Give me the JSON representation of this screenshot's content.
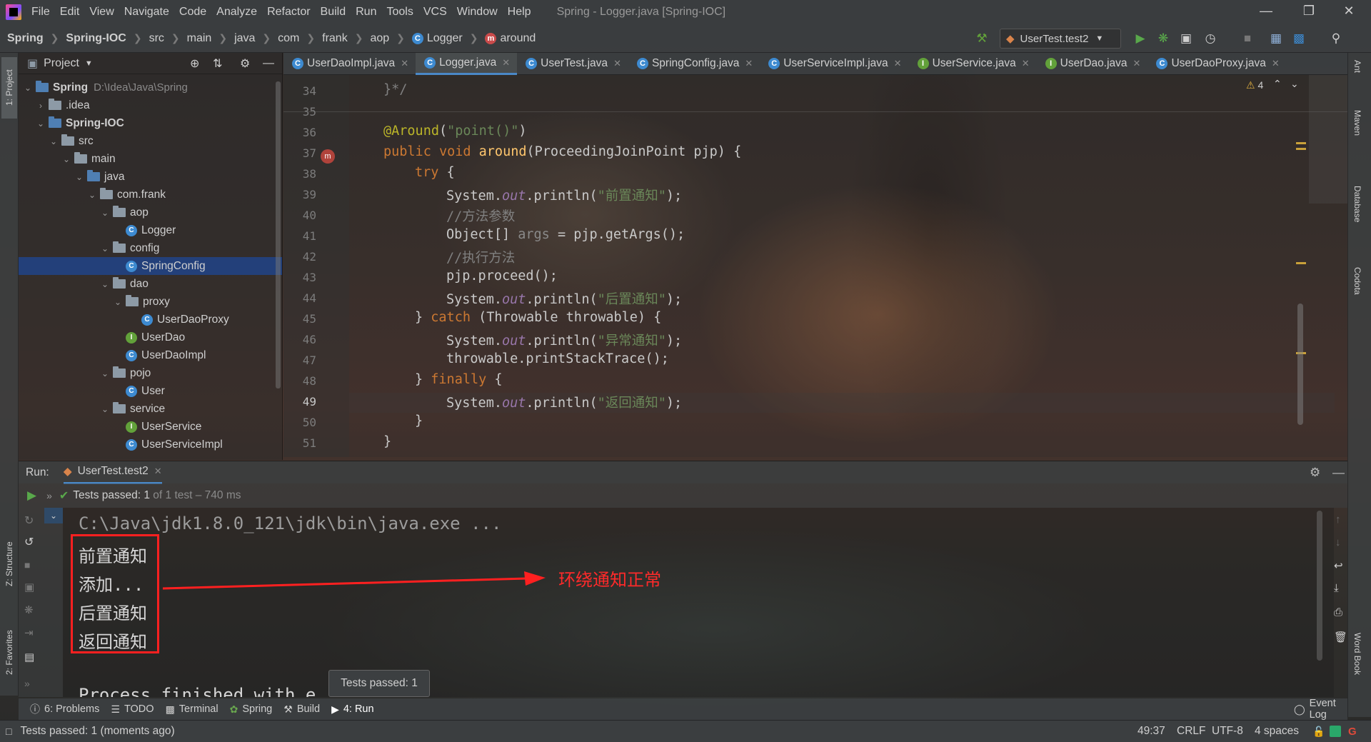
{
  "menubar": {
    "items": [
      "File",
      "Edit",
      "View",
      "Navigate",
      "Code",
      "Analyze",
      "Refactor",
      "Build",
      "Run",
      "Tools",
      "VCS",
      "Window",
      "Help"
    ],
    "window_title": "Spring - Logger.java [Spring-IOC]"
  },
  "navbar": {
    "crumbs": [
      "Spring",
      "Spring-IOC",
      "src",
      "main",
      "java",
      "com",
      "frank",
      "aop",
      "Logger",
      "around"
    ],
    "run_config": "UserTest.test2"
  },
  "left_strip": {
    "project_tab": "1: Project",
    "structure_tab": "Z: Structure",
    "favorites_tab": "2: Favorites"
  },
  "project_panel": {
    "title": "Project",
    "tree": [
      {
        "label": "Spring",
        "path": "D:\\Idea\\Java\\Spring"
      },
      {
        "label": ".idea"
      },
      {
        "label": "Spring-IOC"
      },
      {
        "label": "src"
      },
      {
        "label": "main"
      },
      {
        "label": "java"
      },
      {
        "label": "com.frank"
      },
      {
        "label": "aop"
      },
      {
        "label": "Logger"
      },
      {
        "label": "config"
      },
      {
        "label": "SpringConfig"
      },
      {
        "label": "dao"
      },
      {
        "label": "proxy"
      },
      {
        "label": "UserDaoProxy"
      },
      {
        "label": "UserDao"
      },
      {
        "label": "UserDaoImpl"
      },
      {
        "label": "pojo"
      },
      {
        "label": "User"
      },
      {
        "label": "service"
      },
      {
        "label": "UserService"
      },
      {
        "label": "UserServiceImpl"
      }
    ]
  },
  "editor_tabs": [
    "UserDaoImpl.java",
    "Logger.java",
    "UserTest.java",
    "SpringConfig.java",
    "UserServiceImpl.java",
    "UserService.java",
    "UserDao.java",
    "UserDaoProxy.java"
  ],
  "editor": {
    "warning_count": "4",
    "line_numbers": [
      "34",
      "35",
      "36",
      "37",
      "38",
      "39",
      "40",
      "41",
      "42",
      "43",
      "44",
      "45",
      "46",
      "47",
      "48",
      "49",
      "50",
      "51"
    ],
    "code": {
      "l34": "}*/",
      "l36_ann": "@Around",
      "l36_rest": "(",
      "l36_str": "\"point()\"",
      "l36_end": ")",
      "l37_kw": "public void ",
      "l37_fn": "around",
      "l37_rest": "(ProceedingJoinPoint pjp) {",
      "l38_kw": "try",
      "l38_rest": " {",
      "sys": "System.",
      "out": "out",
      "println": ".println(",
      "l39_str": "\"前置通知\"",
      "close": ");",
      "l40": "//方法参数",
      "l41_a": "Object[] ",
      "l41_b": "args",
      "l41_c": " = pjp.getArgs();",
      "l42": "//执行方法",
      "l43": "pjp.proceed();",
      "l44_str": "\"后置通知\"",
      "l45_a": "} ",
      "l45_kw": "catch",
      "l45_b": " (Throwable throwable) {",
      "l46_str": "\"异常通知\"",
      "l47": "throwable.printStackTrace();",
      "l48_a": "} ",
      "l48_kw": "finally",
      "l48_b": " {",
      "l49_str": "\"返回通知\"",
      "l50": "}",
      "l51": "}"
    }
  },
  "right_strip": {
    "tabs": [
      "Ant",
      "Maven",
      "Database",
      "Codota",
      "Word Book"
    ]
  },
  "run_panel": {
    "label": "Run:",
    "tab": "UserTest.test2",
    "status_prefix": "Tests passed: ",
    "status_count": "1",
    "status_suffix": " of 1 test – 740 ms",
    "console": [
      "C:\\Java\\jdk1.8.0_121\\jdk\\bin\\java.exe ...",
      "前置通知",
      "添加...",
      "后置通知",
      "返回通知",
      "",
      "Process finished with e"
    ],
    "annotation": "环绕通知正常",
    "tooltip": "Tests passed: 1"
  },
  "bottom_tabs": [
    "6: Problems",
    "TODO",
    "Terminal",
    "Spring",
    "Build",
    "4: Run"
  ],
  "event_log": "Event Log",
  "statusbar": {
    "message": "Tests passed: 1 (moments ago)",
    "position": "49:37",
    "line_sep": "CRLF",
    "encoding": "UTF-8",
    "indent": "4 spaces"
  },
  "colors": {
    "accent_blue": "#4a88c7",
    "annotation_red": "#ff2a2a",
    "selection": "#214283"
  }
}
